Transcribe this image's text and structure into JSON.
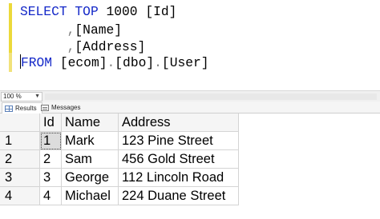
{
  "editor": {
    "line1": {
      "kw1": "SELECT",
      "kw2": "TOP",
      "number": "1000",
      "col": "[Id]"
    },
    "line2": {
      "comma": ",",
      "col": "[Name]"
    },
    "line3": {
      "comma": ",",
      "col": "[Address]"
    },
    "line4": {
      "kw": "FROM",
      "db": "[ecom]",
      "dot1": ".",
      "schema": "[dbo]",
      "dot2": ".",
      "table": "[User]"
    }
  },
  "status": {
    "zoom": "100 %"
  },
  "tabs": [
    {
      "label": "Results",
      "icon": "grid-icon",
      "active": true
    },
    {
      "label": "Messages",
      "icon": "messages-icon",
      "active": false
    }
  ],
  "grid": {
    "columns": [
      "Id",
      "Name",
      "Address"
    ],
    "rows": [
      {
        "rownum": "1",
        "id": "1",
        "name": "Mark",
        "address": "123 Pine Street"
      },
      {
        "rownum": "2",
        "id": "2",
        "name": "Sam",
        "address": "456 Gold Street"
      },
      {
        "rownum": "3",
        "id": "3",
        "name": "George",
        "address": "112 Lincoln Road"
      },
      {
        "rownum": "4",
        "id": "4",
        "name": "Michael",
        "address": "224 Duane Street"
      }
    ]
  },
  "colors": {
    "keyword": "#1428c8",
    "punctuation": "#808080",
    "modified_bar": "#ecd93a"
  }
}
